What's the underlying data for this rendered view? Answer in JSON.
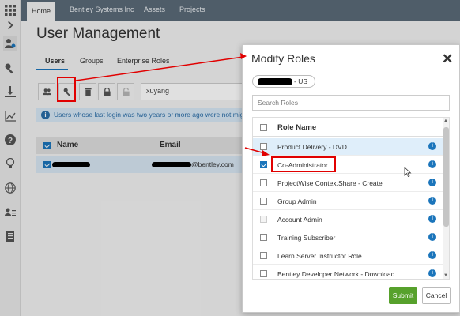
{
  "topbar": {
    "tabs": [
      {
        "label": "Home",
        "active": true
      },
      {
        "label": "Bentley Systems Inc",
        "active": false
      },
      {
        "label": "Assets",
        "active": false
      },
      {
        "label": "Projects",
        "active": false
      }
    ]
  },
  "rail": {
    "icons": [
      "apps-grid-icon",
      "chevron-right-icon",
      "user-gear-icon",
      "key-wrench-icon",
      "download-icon",
      "line-chart-icon",
      "help-icon",
      "lightbulb-icon",
      "globe-icon",
      "users-list-icon",
      "document-icon"
    ]
  },
  "page": {
    "title": "User Management",
    "subtabs": [
      "Users",
      "Groups",
      "Enterprise Roles"
    ],
    "search_value": "xuyang",
    "info_message": "Users whose last login was two years or more ago were not migrated",
    "grid": {
      "headers": [
        "Name",
        "Email"
      ],
      "rows": [
        {
          "email_suffix": "@bentley.com"
        }
      ]
    }
  },
  "modal": {
    "title": "Modify Roles",
    "close_glyph": "✕",
    "org_suffix": "- US",
    "search_placeholder": "Search Roles",
    "column_header": "Role Name",
    "roles": [
      {
        "name": "Product Delivery - DVD",
        "checked": false,
        "disabled": false
      },
      {
        "name": "Co-Administrator",
        "checked": true,
        "disabled": false
      },
      {
        "name": "ProjectWise ContextShare - Create",
        "checked": false,
        "disabled": false
      },
      {
        "name": "Group Admin",
        "checked": false,
        "disabled": false
      },
      {
        "name": "Account Admin",
        "checked": false,
        "disabled": true
      },
      {
        "name": "Training Subscriber",
        "checked": false,
        "disabled": false
      },
      {
        "name": "Learn Server Instructor Role",
        "checked": false,
        "disabled": false
      },
      {
        "name": "Bentley Developer Network - Download",
        "checked": false,
        "disabled": false
      }
    ],
    "submit_label": "Submit",
    "cancel_label": "Cancel"
  },
  "colors": {
    "accent": "#1b75bb",
    "submit": "#57a12c",
    "highlight": "#e10000",
    "topbar": "#5b6a78"
  }
}
